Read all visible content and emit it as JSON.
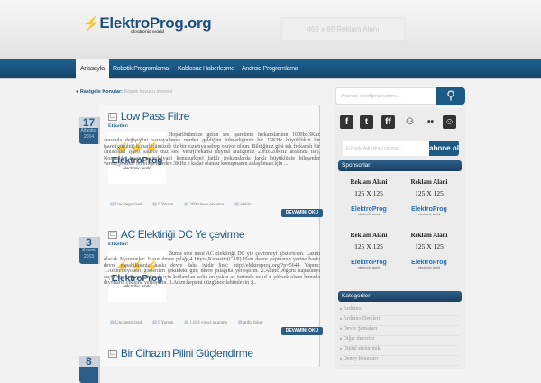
{
  "header": {
    "logo": "ElektroProg.org",
    "logo_sub": "electronic world",
    "ad": "468 x 60 Reklam Alanı"
  },
  "nav": [
    "Anasayfa",
    "Robotik Programlama",
    "Kablosuz Haberleşme",
    "Android Programlama"
  ],
  "crumb": {
    "label": "Rastgele Konular:",
    "value": "Köpek kovucu devresi"
  },
  "search": {
    "placeholder": "Aramak istediğiniz kelime..."
  },
  "posts": [
    {
      "day": "17",
      "month": "Ağustos",
      "year": "2014",
      "title": "Low Pass Filtre",
      "tags": "Etiketler:",
      "text": "Hoparlörümüze gelen ses işaretinin frekanslarının 100Hz-3Khz arasında değiştiğini varsayalımve nerden geldiğini bilmediğimiz bir 15KHz büyüklüklü bir işaret(gürültü) hoparlörümüzde tiz bir cızırtıya sebep oluyor olsun. Bildiğiniz gibi tek frekanslı bir sinüsoidal işaret sadece düz sesi verir(frekansı duyma aralığımız 20Hz-20KHz arasında ise). Normalde insan sesinde(yani konuşurken) farklı frekanslarda farklı büyüklükte bileşenler vardır(pratikte bu bileşenlerden 3KHz e kadar olanlar konuşmanın anlaşılması için ...",
      "category": "Uncategorized",
      "comments": "0 Yorum",
      "views": "369 views okunma",
      "author": "admin",
      "more": "DEVAMINI OKU"
    },
    {
      "day": "3",
      "month": "Kasım",
      "year": "2013",
      "title": "AC Elektiriği DC Ye çevirme",
      "tags": "Etiketler:",
      "text": "Burda size nasıl AC elektiriği DC yie çevirmeyi göstericem. Lazım olacak Mazemeler: Hazır devre pilağı,4 Diyot,Kapasite(CAP) Hazı devre yapmanın yerine baskı devre yapabilirsiniz baskı devre daha iyidir link: http://elektroprog.org/?p=5644 Yapım: 1.Adım:Diyotları gösterilen şekildeki gibi devre pilağına yerleştirin. 2.Adım:Doğuru kapasiteyi seçin ve bunu yapabilmek için kullanılan volta en yakın az üstünde ve uf u yüksek olsun bunuda diyotların çıkışına yerleştirin. 3.Adım:hepsini düzgünce lehimleyin :)..",
      "category": "Uncategorized",
      "comments": "0 Yorum",
      "views": "1.613 views okunma",
      "author": "atilla foker",
      "more": "DEVAMINI OKU"
    },
    {
      "day": "8",
      "title": "Bir Cihazın Pilini Güçlendirme"
    }
  ],
  "thumb": {
    "brand": "ElektroProg",
    "sub": "electronic world"
  },
  "sidebar": {
    "email_placeholder": "E-Posta Adresinizi yazınız...",
    "subscribe": "abone ol",
    "sponsors_title": "Sponsorlar",
    "ad_title": "Reklam Alani",
    "ad_size": "125 X 125",
    "ad_brand": "ElektroProg",
    "ad_sub": "electronic world",
    "categories_title": "Kategoriler",
    "categories": [
      "Arduino",
      "Arduino Dersleri",
      "Devre Şemaları",
      "Diğer devreler",
      "Dijital elektronik",
      "Deney Konuları"
    ]
  }
}
